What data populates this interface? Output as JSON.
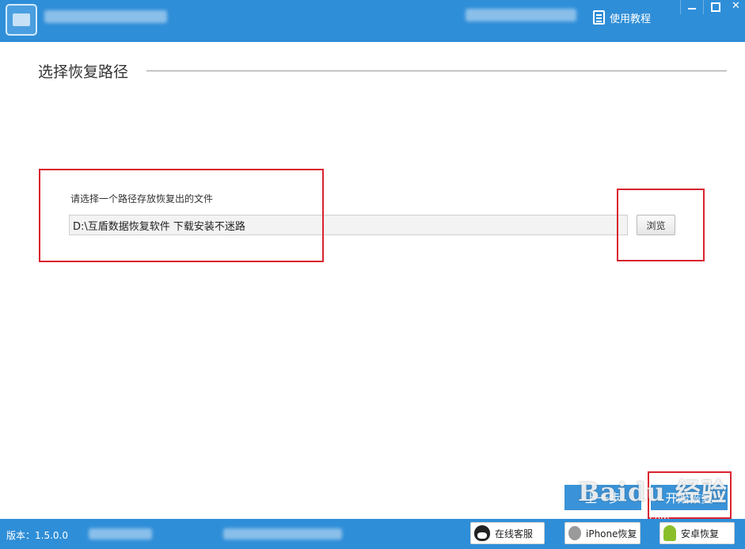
{
  "header": {
    "tutorial_label": "使用教程",
    "icons": {
      "logo": "app-logo-icon",
      "tutorial": "document-icon",
      "minimize": "minimize-icon",
      "maximize": "maximize-icon",
      "close": "close-icon"
    },
    "close_glyph": "✕"
  },
  "section": {
    "title": "选择恢复路径"
  },
  "path_chooser": {
    "label": "请选择一个路径存放恢复出的文件",
    "path_value": "D:\\互盾数据恢复软件 下载安装不迷路",
    "browse_label": "浏览"
  },
  "actions": {
    "prev_label": "上一步",
    "start_label": "开始恢复"
  },
  "watermark": {
    "text": "Baidu 经验",
    "url": "jingyan.baidu.com"
  },
  "footer": {
    "version": "版本：1.5.0.0",
    "online_service": "在线客服",
    "iphone_recovery": "iPhone恢复",
    "android_recovery": "安卓恢复"
  },
  "colors": {
    "brand_blue": "#2f8ed8",
    "annotation_red": "#d9232e"
  }
}
